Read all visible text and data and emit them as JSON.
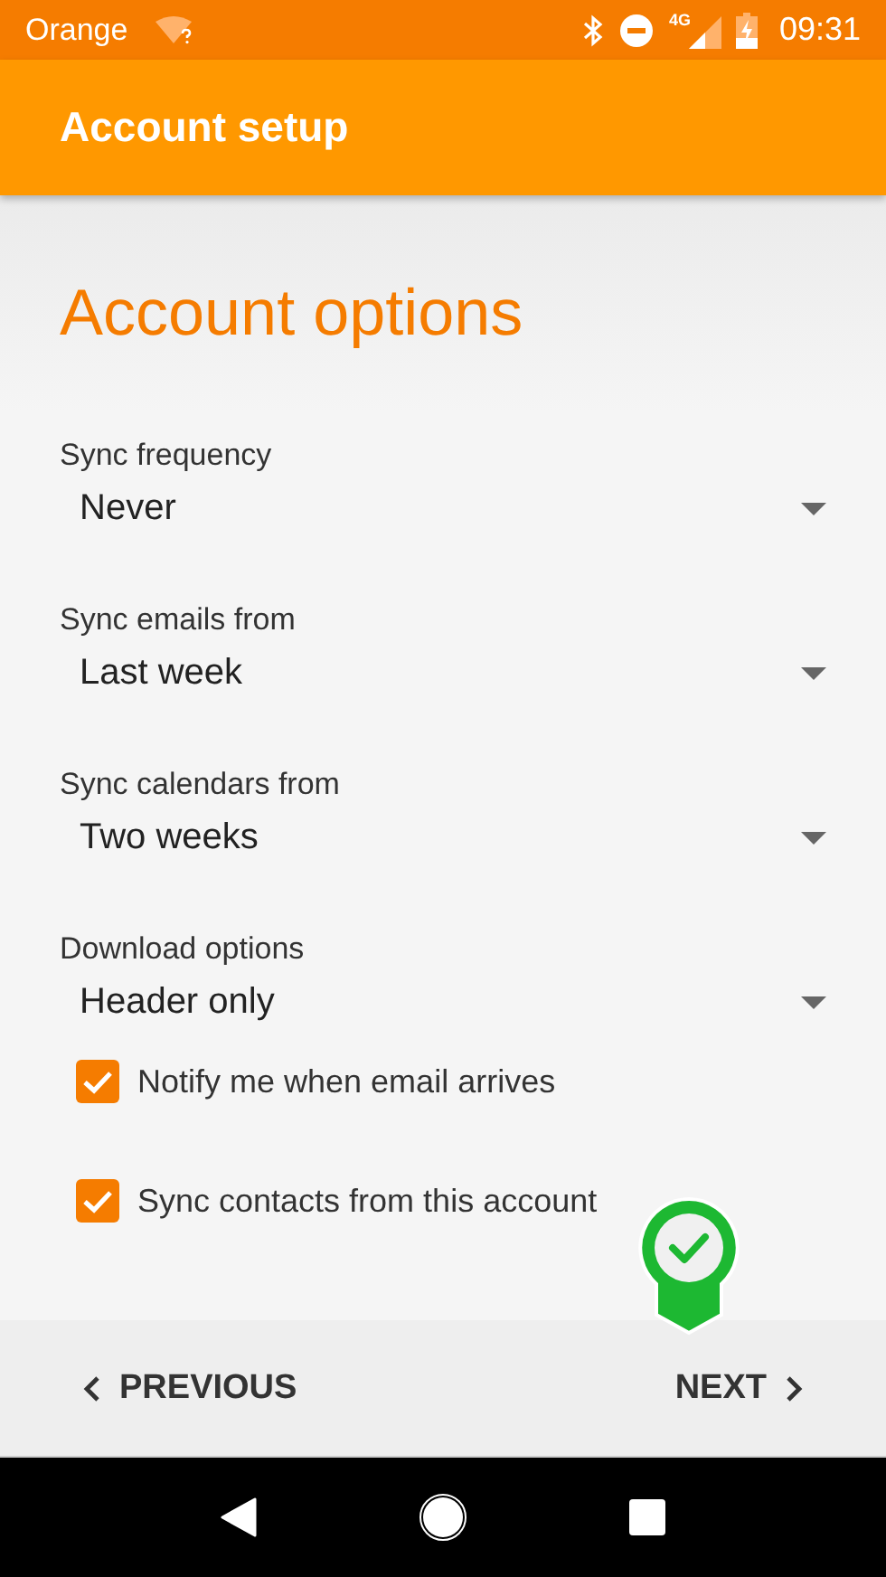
{
  "status_bar": {
    "carrier": "Orange",
    "network": "4G",
    "time": "09:31"
  },
  "toolbar": {
    "title": "Account setup"
  },
  "heading": "Account options",
  "settings": [
    {
      "label": "Sync frequency",
      "value": "Never"
    },
    {
      "label": "Sync emails from",
      "value": "Last week"
    },
    {
      "label": "Sync calendars from",
      "value": "Two weeks"
    },
    {
      "label": "Download options",
      "value": "Header only"
    }
  ],
  "checkboxes": [
    {
      "label": "Notify me when email arrives",
      "checked": true
    },
    {
      "label": "Sync contacts from this account",
      "checked": true
    }
  ],
  "footer": {
    "previous": "PREVIOUS",
    "next": "NEXT"
  }
}
